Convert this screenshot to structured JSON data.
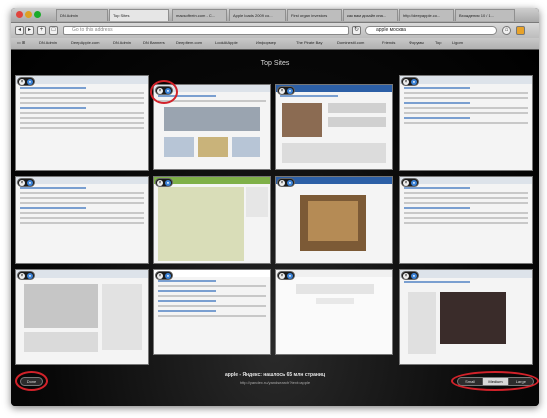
{
  "window": {
    "tabs": [
      {
        "label": "DN Admin",
        "active": false
      },
      {
        "label": "Top Sites",
        "active": true
      },
      {
        "label": "macsoftrein.com - C...",
        "active": false
      },
      {
        "label": "Apple loads 2009 co...",
        "active": false
      },
      {
        "label": "First organ investors",
        "active": false
      },
      {
        "label": "как вам дизайн ипа...",
        "active": false
      },
      {
        "label": "http://deepapple.co...",
        "active": false
      },
      {
        "label": "Вхождения 10 / 1...",
        "active": false
      }
    ],
    "url_placeholder": "Go to this address",
    "search_value": "apple москва",
    "bookmarks": [
      "DN Admin",
      "DeepApple.com",
      "DN Admin",
      "DN Banners",
      "DeepItem.com",
      "LookAtApple",
      "Информер",
      "The Pirate Bay",
      "Dominestil.com",
      "Friends",
      "Форумы",
      "Top",
      "Ligom"
    ]
  },
  "top_sites": {
    "title": "Top Sites",
    "hovered_title": "apple - Яндекс: нашлось 65 млн страниц",
    "hovered_url": "http://yandex.ru/yandsearch?text=apple",
    "done_label": "Done",
    "size_options": [
      "Small",
      "Medium",
      "Large"
    ],
    "selected_size": "Medium"
  },
  "colors": {
    "highlight_ring": "#d2222a",
    "pin_blue": "#3b82d6"
  }
}
